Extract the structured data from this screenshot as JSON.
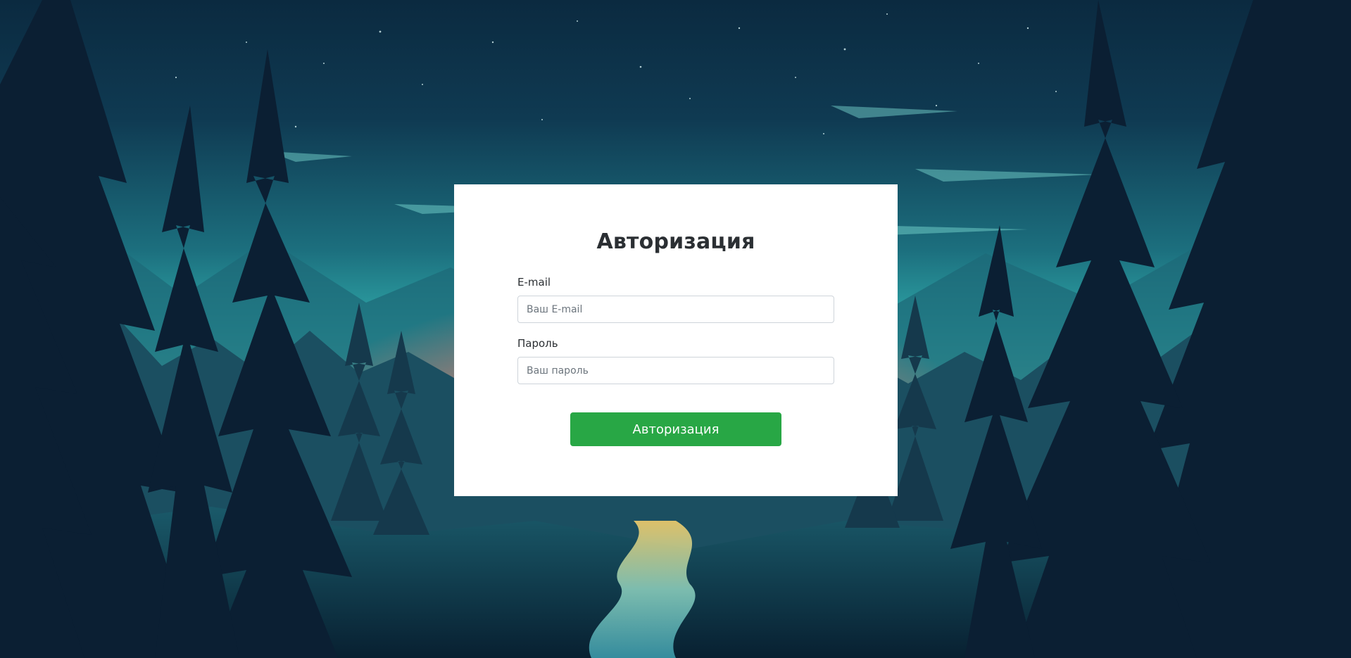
{
  "background": {
    "image": "forest-night-landscape",
    "sky_top_color": "#0b2a40",
    "sky_horizon_color": "#2fb9b8",
    "sunset_color": "#f0a16a",
    "tree_color": "#0b1f33"
  },
  "login": {
    "title": "Авторизация",
    "email_label": "E-mail",
    "email_placeholder": "Ваш E-mail",
    "email_value": "",
    "password_label": "Пароль",
    "password_placeholder": "Ваш пароль",
    "password_value": "",
    "submit_label": "Авторизация",
    "submit_color": "#28a745"
  }
}
